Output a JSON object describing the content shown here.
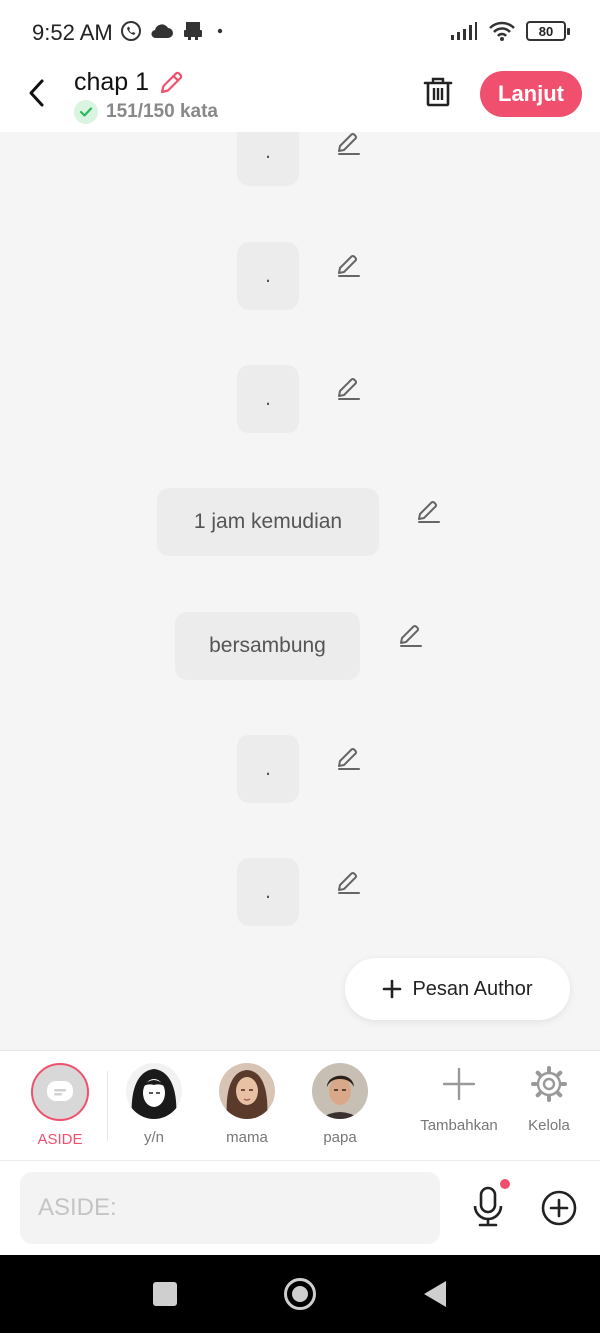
{
  "status_bar": {
    "time": "9:52 AM",
    "battery": "80",
    "left_icons": [
      "whatsapp-icon",
      "cloud-icon",
      "printer-icon",
      "dot-icon"
    ],
    "right_icons": [
      "signal-icon",
      "wifi-icon",
      "battery-icon"
    ]
  },
  "header": {
    "title": "chap 1",
    "word_count": "151/150 kata",
    "next_label": "Lanjut",
    "accent": "#f0506e"
  },
  "messages": [
    {
      "text": "."
    },
    {
      "text": "."
    },
    {
      "text": "."
    },
    {
      "text": "1 jam kemudian"
    },
    {
      "text": "bersambung"
    },
    {
      "text": "."
    },
    {
      "text": "."
    }
  ],
  "fab": {
    "label": "Pesan Author"
  },
  "characters": [
    {
      "name": "ASIDE",
      "active": true
    },
    {
      "name": "y/n"
    },
    {
      "name": "mama"
    },
    {
      "name": "papa"
    }
  ],
  "char_actions": {
    "add_label": "Tambahkan",
    "manage_label": "Kelola"
  },
  "input": {
    "placeholder": "ASIDE:"
  }
}
